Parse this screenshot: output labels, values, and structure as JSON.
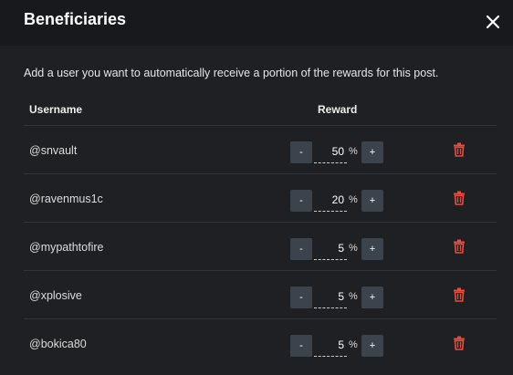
{
  "dialog": {
    "title": "Beneficiaries",
    "description": "Add a user you want to automatically receive a portion of the rewards for this post.",
    "columns": {
      "username": "Username",
      "reward": "Reward"
    },
    "percent_sign": "%",
    "minus_label": "-",
    "plus_label": "+",
    "beneficiaries": [
      {
        "username": "@snvault",
        "reward": "50"
      },
      {
        "username": "@ravenmus1c",
        "reward": "20"
      },
      {
        "username": "@mypathtofire",
        "reward": "5"
      },
      {
        "username": "@xplosive",
        "reward": "5"
      },
      {
        "username": "@bokica80",
        "reward": "5"
      }
    ]
  },
  "colors": {
    "accent_delete": "#e74c3c",
    "stepper_button": "#3b444c",
    "background": "#1f2023"
  },
  "icons": {
    "close": "close-icon",
    "delete": "trash-icon"
  }
}
